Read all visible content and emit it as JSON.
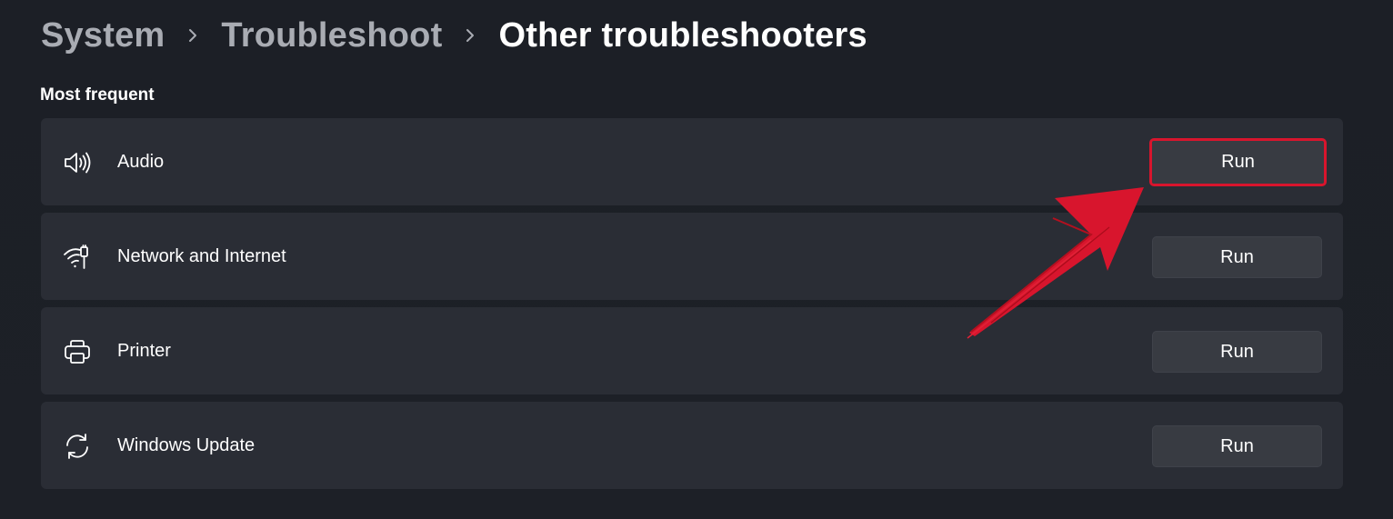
{
  "breadcrumb": {
    "items": [
      "System",
      "Troubleshoot",
      "Other troubleshooters"
    ],
    "separator_icon": "chevron-right-icon"
  },
  "section": {
    "title": "Most frequent"
  },
  "troubleshooters": [
    {
      "label": "Audio",
      "icon": "speaker-icon",
      "button_label": "Run",
      "highlighted": true
    },
    {
      "label": "Network and Internet",
      "icon": "wifi-icon",
      "button_label": "Run",
      "highlighted": false
    },
    {
      "label": "Printer",
      "icon": "printer-icon",
      "button_label": "Run",
      "highlighted": false
    },
    {
      "label": "Windows Update",
      "icon": "sync-icon",
      "button_label": "Run",
      "highlighted": false
    }
  ],
  "colors": {
    "background": "#1c1f26",
    "card": "#2a2d35",
    "button": "#383b42",
    "highlight": "#d8152d",
    "inactive_crumb": "#a9acb3"
  }
}
